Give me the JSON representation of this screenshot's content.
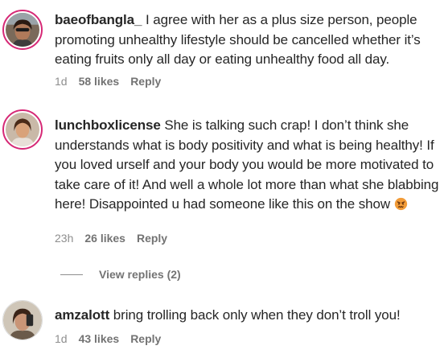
{
  "comments": [
    {
      "username": "baeofbangla_",
      "text": " I agree with her as a plus size person, people promoting unhealthy lifestyle should be cancelled whether it’s eating fruits only all day or eating unhealthy food all day.",
      "time": "1d",
      "likes": "58 likes",
      "reply": "Reply",
      "avatar_icon": "avatar-photo-icon"
    },
    {
      "username": "lunchboxlicense",
      "text": " She is talking such crap! I don’t think she understands what is body positivity and what is being healthy! If you loved urself and your body you would be more motivated to take care of it! And well a whole lot more than what she blabbing here! Disappointed u had someone like this on the show ",
      "emoji": "angry-face-emoji",
      "time": "23h",
      "likes": "26 likes",
      "reply": "Reply",
      "view_replies": "View replies (2)",
      "avatar_icon": "avatar-photo-icon"
    },
    {
      "username": "amzalott",
      "text": " bring trolling back only when they don’t troll you!",
      "time": "1d",
      "likes": "43 likes",
      "reply": "Reply",
      "avatar_icon": "avatar-photo-icon"
    }
  ],
  "colors": {
    "story_ring": "#d62976",
    "meta_text": "#8e8e8e",
    "body_text": "#262626"
  }
}
